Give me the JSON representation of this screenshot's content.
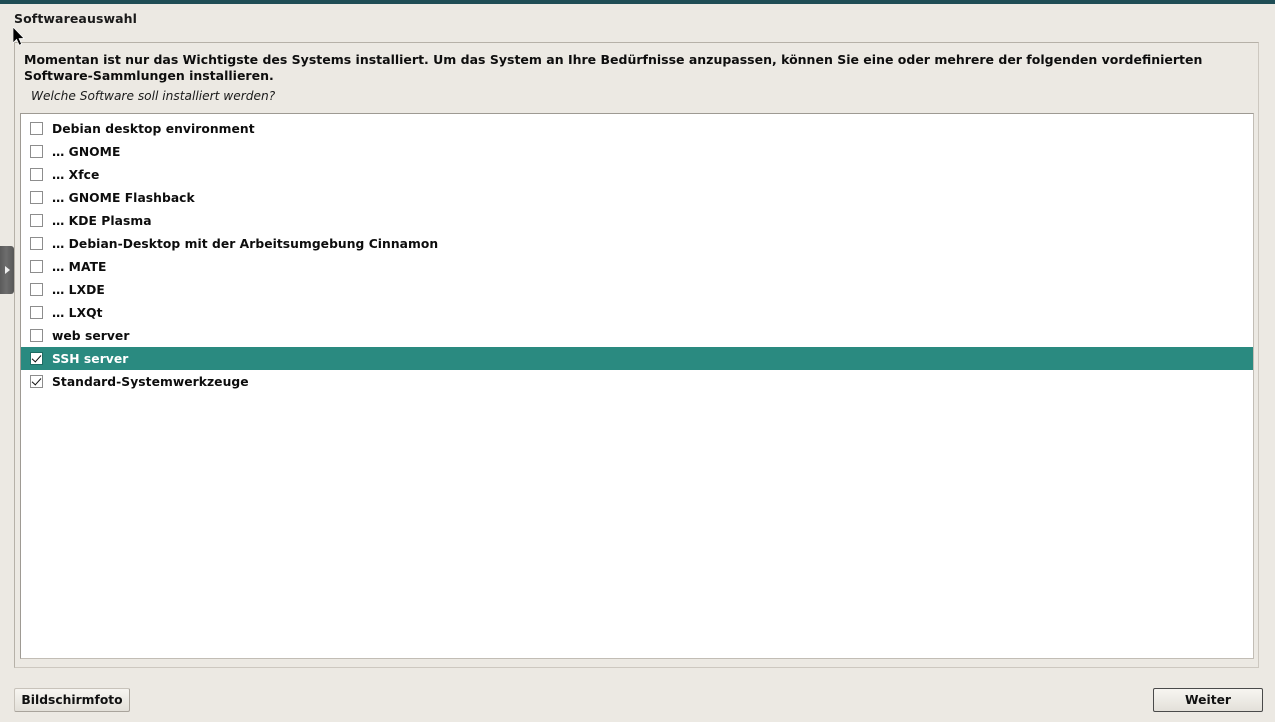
{
  "window": {
    "title": "Softwareauswahl"
  },
  "description": {
    "main": "Momentan ist nur das Wichtigste des Systems installiert. Um das System an Ihre Bedürfnisse anzupassen, können Sie eine oder mehrere der folgenden vordefinierten Software-Sammlungen installieren.",
    "question": "Welche Software soll installiert werden?"
  },
  "software_list": [
    {
      "label": "Debian desktop environment",
      "checked": false,
      "selected": false
    },
    {
      "label": "… GNOME",
      "checked": false,
      "selected": false
    },
    {
      "label": "… Xfce",
      "checked": false,
      "selected": false
    },
    {
      "label": "… GNOME Flashback",
      "checked": false,
      "selected": false
    },
    {
      "label": "… KDE Plasma",
      "checked": false,
      "selected": false
    },
    {
      "label": "… Debian-Desktop mit der Arbeitsumgebung Cinnamon",
      "checked": false,
      "selected": false
    },
    {
      "label": "… MATE",
      "checked": false,
      "selected": false
    },
    {
      "label": "… LXDE",
      "checked": false,
      "selected": false
    },
    {
      "label": "… LXQt",
      "checked": false,
      "selected": false
    },
    {
      "label": "web server",
      "checked": false,
      "selected": false
    },
    {
      "label": "SSH server",
      "checked": true,
      "selected": true
    },
    {
      "label": "Standard-Systemwerkzeuge",
      "checked": true,
      "selected": false
    }
  ],
  "buttons": {
    "screenshot": "Bildschirmfoto",
    "continue": "Weiter"
  },
  "icons": {
    "sidebar_expand": "chevron-right-icon",
    "cursor": "mouse-pointer-icon"
  },
  "colors": {
    "selection_teal": "#2a8a80",
    "top_strip": "#1f4d55",
    "background": "#ece9e3",
    "list_background": "#ffffff"
  }
}
